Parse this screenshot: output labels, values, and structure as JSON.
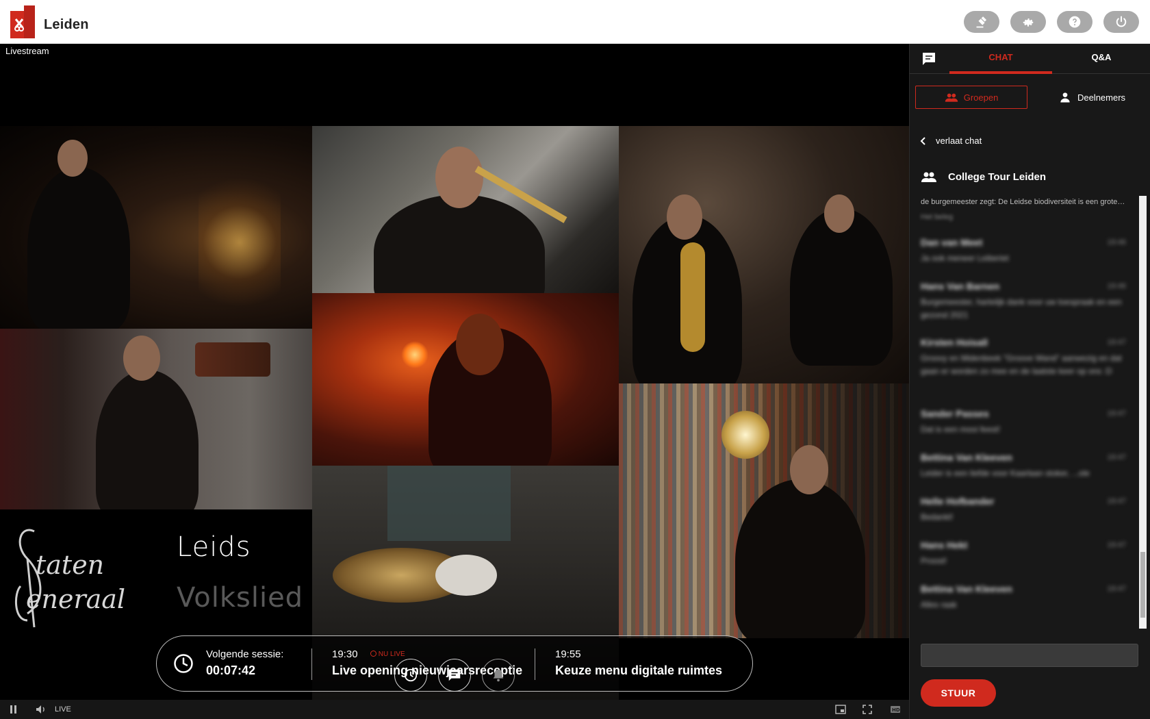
{
  "header": {
    "brand": "Leiden",
    "brand_color": "#d02a1e",
    "buttons": [
      {
        "icon": "gavel-icon"
      },
      {
        "icon": "gear-icon"
      },
      {
        "icon": "help-icon"
      },
      {
        "icon": "power-icon"
      }
    ]
  },
  "stage": {
    "label": "Livestream",
    "overlay": {
      "signature": "Staten Generaal",
      "title_line1": "Leids",
      "title_line2": "Volkslied"
    }
  },
  "session_bar": {
    "next_label": "Volgende sessie:",
    "countdown": "00:07:42",
    "items": [
      {
        "time": "19:30",
        "badge": "NU LIVE",
        "title": "Live opening nieuwjaarsreceptie"
      },
      {
        "time": "19:55",
        "title": "Keuze menu digitale ruimtes"
      }
    ]
  },
  "round_buttons": [
    {
      "icon": "clock-icon"
    },
    {
      "icon": "chat-icon"
    },
    {
      "icon": "bell-icon"
    }
  ],
  "player": {
    "live_label": "LIVE"
  },
  "panel": {
    "tabs": [
      {
        "label": "CHAT",
        "active": true
      },
      {
        "label": "Q&A",
        "active": false
      }
    ],
    "segments": [
      {
        "label": "Groepen",
        "active": true
      },
      {
        "label": "Deelnemers",
        "active": false
      }
    ],
    "back_label": "verlaat chat",
    "group_name": "College Tour Leiden",
    "top_message": "de burgemeester zegt: De Leidse biodiversiteit is een grote…",
    "top_message_sub": "Het beleg",
    "messages": [
      {
        "name": "Dan van Meet",
        "time": "19:46",
        "text": "Ja ook meneer Leiberiet"
      },
      {
        "name": "Hans Van Barnen",
        "time": "19:46",
        "text": "Burgemeester, hartelijk dank voor uw toespraak en een gezond 2021"
      },
      {
        "name": "Kirsten Hoisall",
        "time": "19:47",
        "text": "Groovy en Midenbeek \"Groove Wand\" aanwezig en dat gaan er worden zo mee en de laatste keer op ons :D"
      },
      {
        "name": "Sander Passes",
        "time": "19:47",
        "text": "Dat is een mooi feest!"
      },
      {
        "name": "Bettina Van Kleeven",
        "time": "19:47",
        "text": "Leider is een liefde voor Kaarlaan stoker, ...ole"
      },
      {
        "name": "Helle Hofbander",
        "time": "19:47",
        "text": "Bedankt!"
      },
      {
        "name": "Hans Hekt",
        "time": "19:47",
        "text": "Proost!"
      },
      {
        "name": "Bettina Van Kleeven",
        "time": "19:47",
        "text": "Alles raak"
      }
    ],
    "send_label": "STUUR"
  }
}
